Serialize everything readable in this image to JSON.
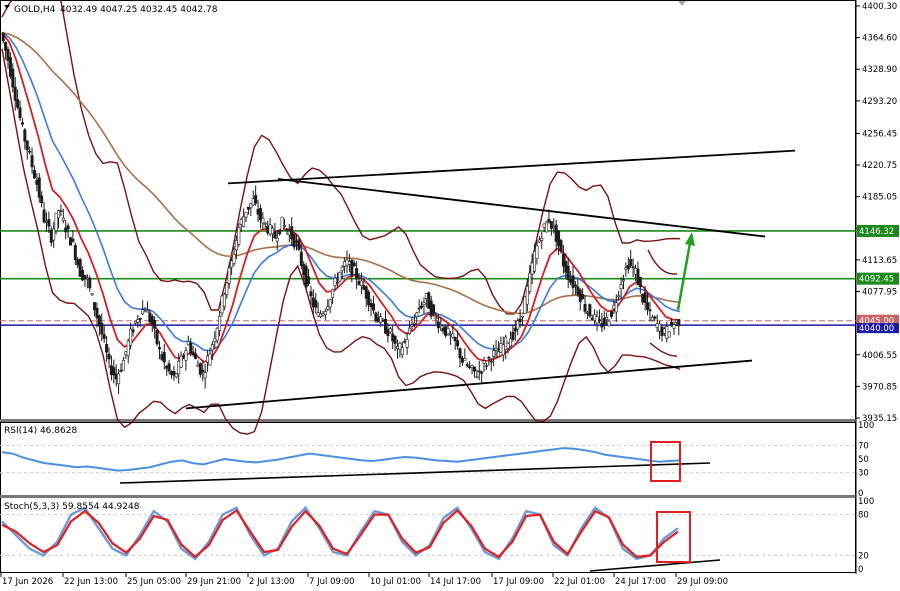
{
  "header": {
    "symbol": "GOLD,H4",
    "ohlc": "4032.49 4047.25 4032.45 4042.78"
  },
  "price_axis": {
    "ticks": [
      "4400.30",
      "4364.60",
      "4328.90",
      "4293.20",
      "4256.45",
      "4220.75",
      "4185.05",
      "4149.35",
      "4113.65",
      "4077.95",
      "4042.20",
      "4006.55",
      "3970.85",
      "3935.15"
    ]
  },
  "levels": [
    {
      "label": "4146.32",
      "value": 4146.32,
      "color": "#1a8a1a"
    },
    {
      "label": "4092.45",
      "value": 4092.45,
      "color": "#1a8a1a"
    },
    {
      "label": "4045.00",
      "value": 4045.0,
      "color": "#c86464"
    },
    {
      "label": "4040.00",
      "value": 4040.0,
      "color": "#1a1aa8"
    }
  ],
  "time_axis": {
    "labels": [
      "17 Jun 2026",
      "22 Jun 13:00",
      "25 Jun 05:00",
      "29 Jun 21:00",
      "2 Jul 13:00",
      "7 Jul 09:00",
      "10 Jul 01:00",
      "14 Jul 17:00",
      "17 Jul 09:00",
      "22 Jul 01:00",
      "24 Jul 17:00",
      "29 Jul 09:00"
    ]
  },
  "rsi_panel": {
    "title": "RSI(14) 46.8628",
    "ticks": [
      "100",
      "70",
      "50",
      "30",
      "0"
    ]
  },
  "stoch_panel": {
    "title": "Stoch(5,3,3) 59.8554 44.9248",
    "ticks": [
      "100",
      "80",
      "20",
      "0"
    ]
  },
  "colors": {
    "up_candle": "#1c1c1c",
    "down_candle": "#1c1c1c",
    "ma_fast": "#d42020",
    "ma_mid": "#3a7be0",
    "ma_slow": "#a8704a",
    "bollinger": "#7a1010",
    "trend": "#000000",
    "rsi": "#4a90e0",
    "stoch_main": "#6a9ad8",
    "stoch_signal": "#e02020",
    "highlight_box": "#e02020",
    "arrow": "#20a020"
  },
  "chart_data": {
    "type": "candlestick",
    "symbol": "GOLD",
    "timeframe": "H4",
    "y_range": [
      3935.15,
      4400.3
    ],
    "x_labels": [
      "17 Jun 2026",
      "22 Jun 13:00",
      "25 Jun 05:00",
      "29 Jun 21:00",
      "2 Jul 13:00",
      "7 Jul 09:00",
      "10 Jul 01:00",
      "14 Jul 17:00",
      "17 Jul 09:00",
      "22 Jul 01:00",
      "24 Jul 17:00",
      "29 Jul 09:00"
    ],
    "close_path": [
      4370,
      4340,
      4300,
      4260,
      4230,
      4200,
      4160,
      4140,
      4170,
      4150,
      4130,
      4100,
      4090,
      4060,
      4030,
      3995,
      3980,
      4000,
      4030,
      4050,
      4060,
      4040,
      4010,
      3990,
      3980,
      4000,
      4020,
      4000,
      3985,
      4010,
      4040,
      4080,
      4110,
      4150,
      4170,
      4180,
      4160,
      4150,
      4140,
      4155,
      4145,
      4130,
      4100,
      4070,
      4050,
      4060,
      4080,
      4100,
      4110,
      4100,
      4085,
      4070,
      4050,
      4040,
      4030,
      4010,
      4020,
      4040,
      4060,
      4070,
      4050,
      4040,
      4030,
      4020,
      4000,
      3990,
      3985,
      3995,
      4005,
      4010,
      4020,
      4030,
      4045,
      4080,
      4120,
      4145,
      4160,
      4140,
      4110,
      4090,
      4080,
      4060,
      4050,
      4040,
      4045,
      4060,
      4090,
      4110,
      4100,
      4070,
      4050,
      4040,
      4030,
      4040,
      4045
    ],
    "rsi_path": [
      60,
      58,
      52,
      48,
      44,
      42,
      40,
      38,
      39,
      37,
      35,
      33,
      34,
      36,
      38,
      42,
      46,
      48,
      44,
      42,
      46,
      50,
      48,
      46,
      45,
      47,
      49,
      52,
      55,
      58,
      56,
      54,
      52,
      50,
      48,
      47,
      49,
      51,
      53,
      52,
      50,
      48,
      47,
      46,
      48,
      50,
      52,
      54,
      56,
      58,
      60,
      62,
      64,
      66,
      65,
      63,
      60,
      56,
      54,
      52,
      50,
      48,
      46,
      47,
      48
    ],
    "stoch_main_path": [
      70,
      50,
      30,
      20,
      40,
      80,
      90,
      60,
      30,
      20,
      50,
      85,
      70,
      30,
      15,
      40,
      80,
      90,
      50,
      20,
      30,
      70,
      90,
      60,
      25,
      20,
      55,
      85,
      80,
      40,
      20,
      35,
      75,
      90,
      60,
      25,
      15,
      45,
      85,
      80,
      35,
      20,
      60,
      90,
      75,
      30,
      15,
      20,
      45,
      60
    ],
    "stoch_signal_path": [
      65,
      55,
      38,
      25,
      35,
      70,
      85,
      68,
      38,
      24,
      45,
      78,
      72,
      36,
      18,
      35,
      72,
      86,
      55,
      25,
      28,
      62,
      85,
      64,
      30,
      22,
      50,
      80,
      80,
      45,
      24,
      32,
      68,
      86,
      64,
      30,
      18,
      40,
      78,
      80,
      40,
      22,
      55,
      85,
      76,
      36,
      18,
      20,
      40,
      55
    ]
  }
}
